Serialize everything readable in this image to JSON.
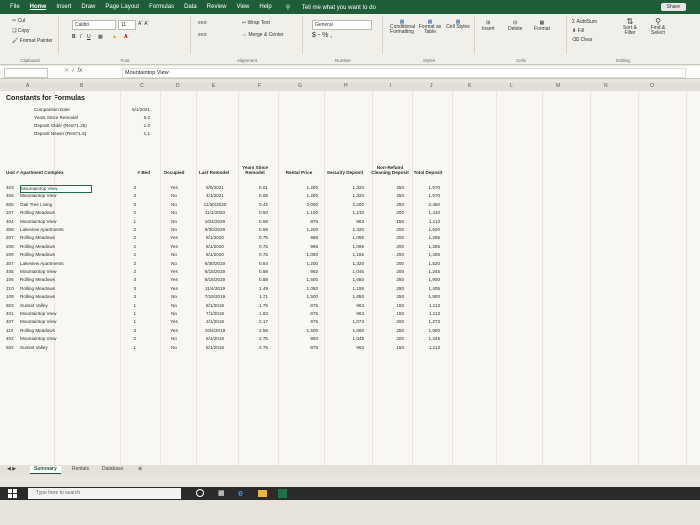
{
  "menu": {
    "items": [
      "File",
      "Home",
      "Insert",
      "Draw",
      "Page Layout",
      "Formulas",
      "Data",
      "Review",
      "View",
      "Help"
    ],
    "tell_me": "Tell me what you want to do",
    "share": "Share"
  },
  "ribbon": {
    "cut": "Cut",
    "copy": "Copy",
    "format_painter": "Format Painter",
    "clipboard": "Clipboard",
    "font_name": "Calibri",
    "font_size": "11",
    "font_label": "Font",
    "wrap_text": "Wrap Text",
    "merge_center": "Merge & Center",
    "alignment": "Alignment",
    "number_format": "General",
    "currency": "$ - % ,",
    "number": "Number",
    "conditional": "Conditional Formatting",
    "format_table": "Format as Table",
    "cell_styles": "Cell Styles",
    "styles": "Styles",
    "insert": "Insert",
    "delete": "Delete",
    "format": "Format",
    "cells": "Cells",
    "autosum": "AutoSum",
    "fill": "Fill",
    "clear": "Clear",
    "sort": "Sort & Filter",
    "find": "Find & Select",
    "editing": "Editing"
  },
  "formula_bar": {
    "fx": "fx",
    "value": "Mountaintop View"
  },
  "columns": [
    "A",
    "B",
    "C",
    "D",
    "E",
    "F",
    "G",
    "H",
    "I",
    "J",
    "K",
    "L",
    "M",
    "N",
    "O"
  ],
  "sheet": {
    "title": "Constants for Formulas",
    "constants": [
      {
        "label": "Comparison Date",
        "value": "5/1/2021"
      },
      {
        "label": "Years Since Remodel",
        "value": "5.0"
      },
      {
        "label": "Deposit Older (Rent*1.25)",
        "value": "1.0"
      },
      {
        "label": "Deposit Newer (Rent*1.5)",
        "value": "1.1"
      }
    ],
    "headers": {
      "unit": "Unit #",
      "complex": "Apartment Complex",
      "bed": "# Bed",
      "occupied": "Occupied",
      "last_remodel": "Last Remodel",
      "years_since": "Years Since Remodel",
      "rent": "Rental Price",
      "security": "Security Deposit",
      "cleaning": "Non-Refund Cleaning Deposit",
      "total": "Total Deposit"
    },
    "rows": [
      [
        "403",
        "Mountaintop View",
        "3",
        "Yes",
        "5/5/2021",
        "0.01",
        "1,200",
        "1,320",
        "250",
        "1,570"
      ],
      [
        "406",
        "Mountaintop View",
        "3",
        "No",
        "4/1/2021",
        "0.08",
        "1,200",
        "1,320",
        "250",
        "1,570"
      ],
      [
        "605",
        "Oak Tree Living",
        "3",
        "No",
        "11/30/2020",
        "0.42",
        "2,000",
        "2,200",
        "250",
        "2,450"
      ],
      [
        "107",
        "Rolling Meadows",
        "2",
        "No",
        "11/1/2020",
        "0.50",
        "1,100",
        "1,210",
        "200",
        "1,410"
      ],
      [
        "404",
        "Mountaintop View",
        "1",
        "No",
        "10/4/2020",
        "0.58",
        "875",
        "963",
        "150",
        "1,113"
      ],
      [
        "308",
        "Lakeview Apartments",
        "2",
        "No",
        "9/30/2020",
        "0.59",
        "1,200",
        "1,320",
        "200",
        "1,520"
      ],
      [
        "207",
        "Rolling Meadows",
        "2",
        "Yes",
        "8/1/2020",
        "0.75",
        "995",
        "1,095",
        "200",
        "1,295"
      ],
      [
        "208",
        "Rolling Meadows",
        "2",
        "Yes",
        "8/1/2020",
        "0.75",
        "995",
        "1,095",
        "200",
        "1,295"
      ],
      [
        "209",
        "Rolling Meadows",
        "2",
        "No",
        "8/1/2020",
        "0.75",
        "1,050",
        "1,155",
        "250",
        "1,405"
      ],
      [
        "307",
        "Lakeview Apartments",
        "2",
        "No",
        "6/30/2020",
        "0.84",
        "1,200",
        "1,320",
        "200",
        "1,520"
      ],
      [
        "405",
        "Mountaintop View",
        "2",
        "Yes",
        "6/15/2020",
        "0.88",
        "950",
        "1,045",
        "200",
        "1,245"
      ],
      [
        "106",
        "Rolling Meadows",
        "3",
        "Yes",
        "6/15/2020",
        "0.88",
        "1,500",
        "1,650",
        "250",
        "1,900"
      ],
      [
        "210",
        "Rolling Meadows",
        "3",
        "Yes",
        "11/4/2019",
        "1.49",
        "1,050",
        "1,155",
        "250",
        "1,405"
      ],
      [
        "109",
        "Rolling Meadows",
        "3",
        "No",
        "7/15/2019",
        "1.71",
        "1,500",
        "1,650",
        "250",
        "1,900"
      ],
      [
        "503",
        "Sunset Valley",
        "1",
        "No",
        "8/1/2019",
        "1.75",
        "875",
        "963",
        "150",
        "1,113"
      ],
      [
        "401",
        "Mountaintop View",
        "1",
        "No",
        "7/1/2019",
        "1.83",
        "875",
        "963",
        "150",
        "1,113"
      ],
      [
        "407",
        "Mountaintop View",
        "1",
        "Yes",
        "3/1/2019",
        "2.17",
        "975",
        "1,073",
        "200",
        "1,273"
      ],
      [
        "110",
        "Rolling Meadows",
        "3",
        "Yes",
        "10/4/2018",
        "2.58",
        "1,500",
        "1,650",
        "250",
        "1,900"
      ],
      [
        "402",
        "Mountaintop View",
        "2",
        "No",
        "8/1/2018",
        "2.75",
        "950",
        "1,045",
        "200",
        "1,245"
      ],
      [
        "502",
        "Sunset Valley",
        "1",
        "No",
        "8/1/2018",
        "2.75",
        "875",
        "963",
        "150",
        "1,113"
      ]
    ]
  },
  "tabs": [
    "Summary",
    "Rentals",
    "Database"
  ],
  "taskbar": {
    "search": "Type here to search"
  }
}
